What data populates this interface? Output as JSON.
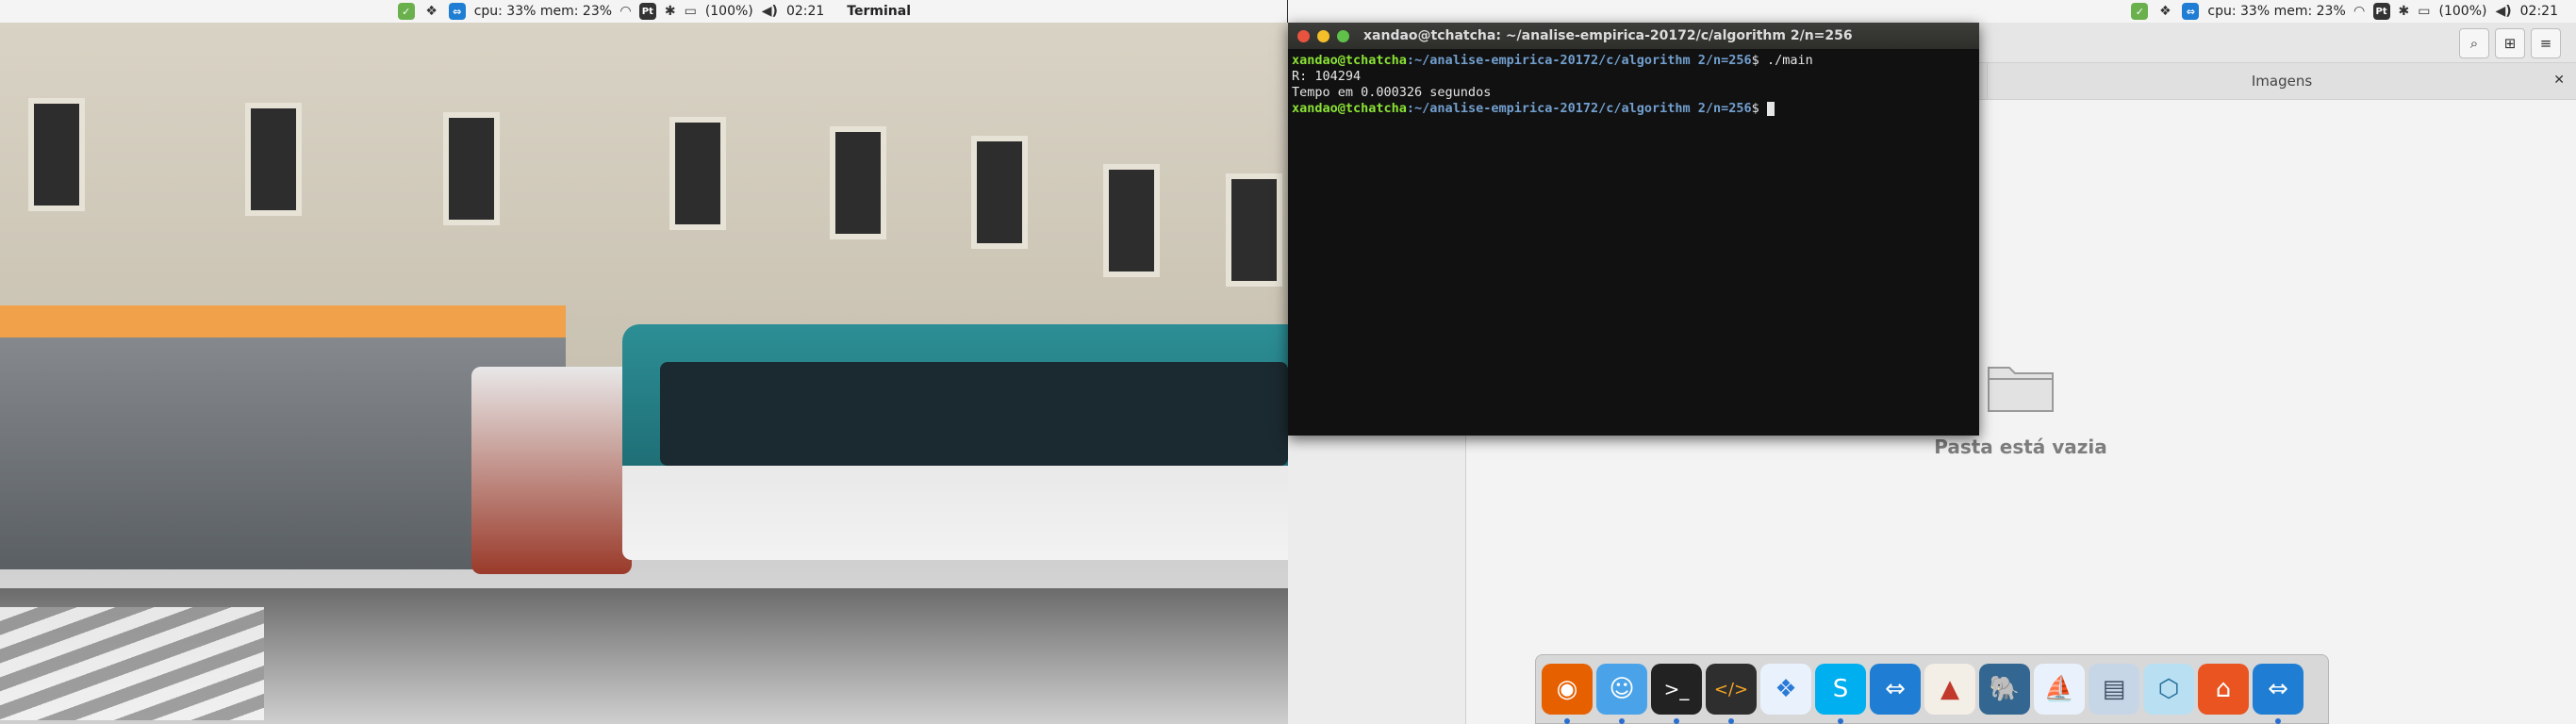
{
  "topbar_left": {
    "cpu_mem": "cpu: 33% mem: 23%",
    "battery": "(100%)",
    "time": "02:21",
    "app_name": "Terminal"
  },
  "topbar_right": {
    "cpu_mem": "cpu: 33% mem: 23%",
    "battery": "(100%)",
    "time": "02:21"
  },
  "terminal": {
    "title": "xandao@tchatcha: ~/analise-empirica-20172/c/algorithm 2/n=256",
    "prompt_user": "xandao@tchatcha",
    "prompt_path": ":~/analise-empirica-20172/c/algorithm 2/n=256",
    "prompt_symbol": "$ ",
    "command": "./main",
    "output_line1": "R: 104294",
    "output_line2": "Tempo em 0.000326 segundos"
  },
  "file_manager": {
    "tab_images": "Imagens",
    "empty_message": "Pasta está vazia"
  },
  "dock": {
    "items": [
      "firefox",
      "finder",
      "terminal",
      "code-editor",
      "dropbox",
      "skype",
      "teamviewer",
      "matlab",
      "postgresql",
      "mysql-workbench",
      "database-tool",
      "virtualbox",
      "ubuntu-software",
      "teamviewer"
    ]
  },
  "colors": {
    "prompt_user": "#8ae234",
    "prompt_path": "#729fcf",
    "terminal_bg": "#111111"
  }
}
